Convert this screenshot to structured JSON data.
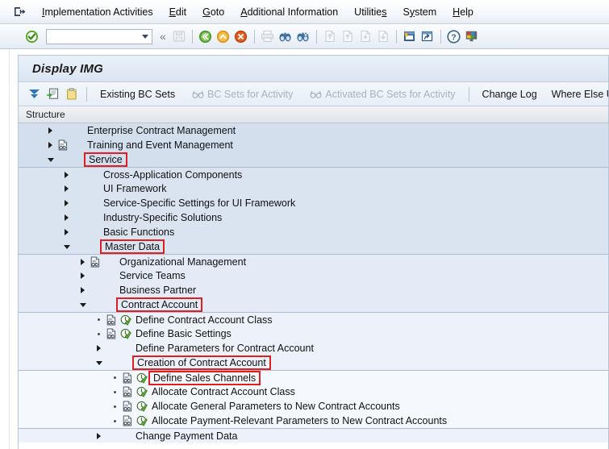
{
  "menubar": {
    "back_icon": "exit-arrow-icon",
    "items": [
      {
        "name": "implementation-activities",
        "label": "Implementation Activities",
        "accel": "I"
      },
      {
        "name": "edit",
        "label": "Edit",
        "accel": "E"
      },
      {
        "name": "goto",
        "label": "Goto",
        "accel": "G"
      },
      {
        "name": "additional-information",
        "label": "Additional Information",
        "accel": "A"
      },
      {
        "name": "utilities",
        "label": "Utilities",
        "accel": "s"
      },
      {
        "name": "system",
        "label": "System",
        "accel": "y"
      },
      {
        "name": "help",
        "label": "Help",
        "accel": "H"
      }
    ]
  },
  "toolbar": {
    "enter_icon": "green-check-enter-icon",
    "command_field": {
      "value": "",
      "placeholder": ""
    },
    "collapse_icon": "double-chevron-left-icon",
    "icons": [
      {
        "name": "save-icon",
        "enabled": false
      },
      {
        "name": "back-green-icon",
        "enabled": true
      },
      {
        "name": "exit-yellow-icon",
        "enabled": true
      },
      {
        "name": "cancel-red-icon",
        "enabled": true
      },
      {
        "name": "print-icon",
        "enabled": false
      },
      {
        "name": "find-icon",
        "enabled": true
      },
      {
        "name": "find-next-icon",
        "enabled": true
      },
      {
        "name": "first-page-icon",
        "enabled": false
      },
      {
        "name": "previous-page-icon",
        "enabled": false
      },
      {
        "name": "next-page-icon",
        "enabled": false
      },
      {
        "name": "last-page-icon",
        "enabled": false
      },
      {
        "name": "create-session-icon",
        "enabled": true
      },
      {
        "name": "create-shortcut-icon",
        "enabled": true
      },
      {
        "name": "help-icon",
        "enabled": true
      },
      {
        "name": "customize-local-layout-icon",
        "enabled": true
      }
    ]
  },
  "panel": {
    "title": "Display IMG",
    "apptoolbar": {
      "icons": [
        {
          "name": "expand-subtree-icon"
        },
        {
          "name": "existing-bc-sets-icon"
        },
        {
          "name": "clipboard-note-icon"
        }
      ],
      "buttons": [
        {
          "name": "existing-bc-sets-button",
          "label": "Existing BC Sets",
          "enabled": true,
          "icon": null
        },
        {
          "name": "bc-sets-for-activity-button",
          "label": "BC Sets for Activity",
          "enabled": false,
          "icon": "bc-set-glasses-icon"
        },
        {
          "name": "activated-bc-sets-for-activity-button",
          "label": "Activated BC Sets for Activity",
          "enabled": false,
          "icon": "bc-set-glasses-icon"
        },
        {
          "name": "change-log-button",
          "label": "Change Log",
          "enabled": true,
          "icon": null
        },
        {
          "name": "where-else-used-button",
          "label": "Where Else Used",
          "enabled": true,
          "icon": null
        }
      ]
    },
    "column_header": "Structure"
  },
  "tree": {
    "rows": [
      {
        "id": "enterprise-contract-management",
        "label": "Enterprise Contract Management",
        "indent": 1,
        "band": 0,
        "twisty": "right",
        "icon": null,
        "status": null,
        "highlight": false,
        "separator": false
      },
      {
        "id": "training-and-event-management",
        "label": "Training and Event Management",
        "indent": 1,
        "band": 0,
        "twisty": "right",
        "icon": "img-doc-icon",
        "status": null,
        "highlight": false,
        "separator": false
      },
      {
        "id": "service",
        "label": "Service",
        "indent": 1,
        "band": 0,
        "twisty": "down",
        "icon": null,
        "status": null,
        "highlight": true,
        "separator": false
      },
      {
        "id": "cross-application-components",
        "label": "Cross-Application Components",
        "indent": 2,
        "band": 1,
        "twisty": "right",
        "icon": null,
        "status": null,
        "highlight": false,
        "separator": true
      },
      {
        "id": "ui-framework",
        "label": "UI Framework",
        "indent": 2,
        "band": 1,
        "twisty": "right",
        "icon": null,
        "status": null,
        "highlight": false,
        "separator": false
      },
      {
        "id": "service-specific-settings-for-ui-framework",
        "label": "Service-Specific Settings for UI Framework",
        "indent": 2,
        "band": 1,
        "twisty": "right",
        "icon": null,
        "status": null,
        "highlight": false,
        "separator": false
      },
      {
        "id": "industry-specific-solutions",
        "label": "Industry-Specific Solutions",
        "indent": 2,
        "band": 1,
        "twisty": "right",
        "icon": null,
        "status": null,
        "highlight": false,
        "separator": false
      },
      {
        "id": "basic-functions",
        "label": "Basic Functions",
        "indent": 2,
        "band": 1,
        "twisty": "right",
        "icon": null,
        "status": null,
        "highlight": false,
        "separator": false
      },
      {
        "id": "master-data",
        "label": "Master Data",
        "indent": 2,
        "band": 1,
        "twisty": "down",
        "icon": null,
        "status": null,
        "highlight": true,
        "separator": false
      },
      {
        "id": "organizational-management",
        "label": "Organizational Management",
        "indent": 3,
        "band": 2,
        "twisty": "right",
        "icon": "img-doc-icon",
        "status": null,
        "highlight": false,
        "separator": true
      },
      {
        "id": "service-teams",
        "label": "Service Teams",
        "indent": 3,
        "band": 2,
        "twisty": "right",
        "icon": null,
        "status": null,
        "highlight": false,
        "separator": false
      },
      {
        "id": "business-partner",
        "label": "Business Partner",
        "indent": 3,
        "band": 2,
        "twisty": "right",
        "icon": null,
        "status": null,
        "highlight": false,
        "separator": false
      },
      {
        "id": "contract-account",
        "label": "Contract Account",
        "indent": 3,
        "band": 2,
        "twisty": "down",
        "icon": null,
        "status": null,
        "highlight": true,
        "separator": false
      },
      {
        "id": "define-contract-account-class",
        "label": "Define Contract Account Class",
        "indent": 4,
        "band": 3,
        "twisty": "leaf",
        "icon": "img-doc-icon",
        "status": "activity-green-check-icon",
        "highlight": false,
        "separator": true
      },
      {
        "id": "define-basic-settings",
        "label": "Define Basic Settings",
        "indent": 4,
        "band": 3,
        "twisty": "leaf",
        "icon": "img-doc-icon",
        "status": "activity-green-check-icon",
        "highlight": false,
        "separator": false
      },
      {
        "id": "define-parameters-for-contract-account",
        "label": "Define Parameters for Contract Account",
        "indent": 4,
        "band": 3,
        "twisty": "right",
        "icon": null,
        "status": null,
        "highlight": false,
        "separator": false
      },
      {
        "id": "creation-of-contract-account",
        "label": "Creation of Contract Account",
        "indent": 4,
        "band": 3,
        "twisty": "down",
        "icon": null,
        "status": null,
        "highlight": true,
        "separator": false
      },
      {
        "id": "define-sales-channels",
        "label": "Define Sales Channels",
        "indent": 5,
        "band": 4,
        "twisty": "leaf",
        "icon": "img-doc-icon",
        "status": "activity-green-check-icon",
        "highlight": true,
        "separator": true
      },
      {
        "id": "allocate-contract-account-class",
        "label": "Allocate Contract Account Class",
        "indent": 5,
        "band": 4,
        "twisty": "leaf",
        "icon": "img-doc-icon",
        "status": "activity-green-check-icon",
        "highlight": false,
        "separator": false
      },
      {
        "id": "allocate-general-parameters-to-new-contract-accounts",
        "label": "Allocate General Parameters to New Contract Accounts",
        "indent": 5,
        "band": 4,
        "twisty": "leaf",
        "icon": "img-doc-icon",
        "status": "activity-green-check-icon",
        "highlight": false,
        "separator": false
      },
      {
        "id": "allocate-payment-relevant-parameters-to-new-contract-accounts",
        "label": "Allocate Payment-Relevant Parameters to New Contract Accounts",
        "indent": 5,
        "band": 4,
        "twisty": "leaf",
        "icon": "img-doc-icon",
        "status": "activity-green-check-icon",
        "highlight": false,
        "separator": false
      },
      {
        "id": "change-payment-data",
        "label": "Change Payment Data",
        "indent": 4,
        "band": 3,
        "twisty": "right",
        "icon": null,
        "status": null,
        "highlight": false,
        "separator": true
      }
    ]
  },
  "colors": {
    "highlight_box": "#e02020",
    "title_bar": "#dbe6f2",
    "band_level_0": "#d3dfed",
    "band_level_4": "#f5f9fd"
  }
}
